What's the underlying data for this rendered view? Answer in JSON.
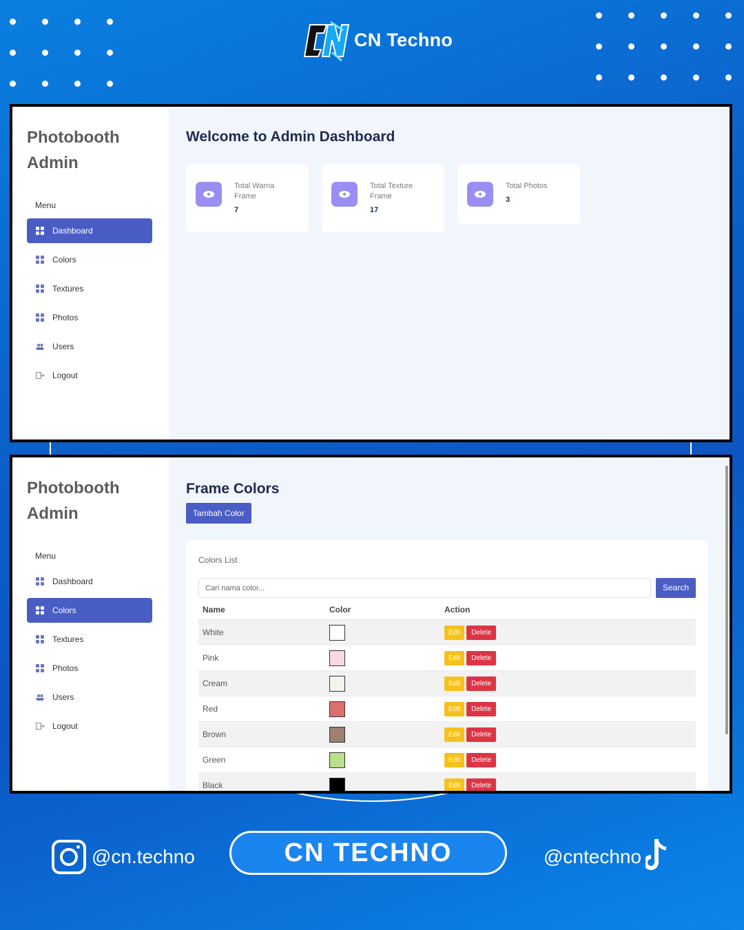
{
  "brand": {
    "name": "CN Techno",
    "logo_text": "CN"
  },
  "screens": [
    {
      "sidebar": {
        "title": "Photobooth Admin",
        "menu_label": "Menu",
        "items": [
          {
            "label": "Dashboard",
            "icon": "grid-icon",
            "active": true
          },
          {
            "label": "Colors",
            "icon": "grid-icon"
          },
          {
            "label": "Textures",
            "icon": "grid-icon"
          },
          {
            "label": "Photos",
            "icon": "grid-icon"
          },
          {
            "label": "Users",
            "icon": "users-icon"
          },
          {
            "label": "Logout",
            "icon": "logout-icon"
          }
        ]
      },
      "main": {
        "title": "Welcome to Admin Dashboard",
        "cards": [
          {
            "label": "Total Warna Frame",
            "value": "7",
            "icon": "eye-icon"
          },
          {
            "label": "Total Texture Frame",
            "value": "17",
            "icon": "eye-icon"
          },
          {
            "label": "Total Photos",
            "value": "3",
            "icon": "eye-icon"
          }
        ]
      }
    },
    {
      "sidebar": {
        "title": "Photobooth Admin",
        "menu_label": "Menu",
        "items": [
          {
            "label": "Dashboard",
            "icon": "grid-icon"
          },
          {
            "label": "Colors",
            "icon": "grid-icon",
            "active": true
          },
          {
            "label": "Textures",
            "icon": "grid-icon"
          },
          {
            "label": "Photos",
            "icon": "grid-icon"
          },
          {
            "label": "Users",
            "icon": "users-icon"
          },
          {
            "label": "Logout",
            "icon": "logout-icon"
          }
        ]
      },
      "main": {
        "title": "Frame Colors",
        "add_button": "Tambah Color",
        "panel_title": "Colors List",
        "search_placeholder": "Cari nama color...",
        "search_button": "Search",
        "columns": [
          "Name",
          "Color",
          "Action"
        ],
        "rows": [
          {
            "name": "White",
            "color": "#ffffff"
          },
          {
            "name": "Pink",
            "color": "#f7d8e4"
          },
          {
            "name": "Cream",
            "color": "#f5f4ea"
          },
          {
            "name": "Red",
            "color": "#dc6e6e"
          },
          {
            "name": "Brown",
            "color": "#9c8070"
          },
          {
            "name": "Green",
            "color": "#b9e08d"
          },
          {
            "name": "Black",
            "color": "#000000"
          }
        ],
        "edit_label": "Edit",
        "delete_label": "Delete"
      }
    }
  ],
  "footer": {
    "instagram": "@cn.techno",
    "center": "CN TECHNO",
    "tiktok": "@cntechno"
  },
  "colors": {
    "accent": "#4a5dc4",
    "card_icon": "#9b8ef2",
    "edit": "#f6c11a",
    "delete": "#dc3545"
  }
}
